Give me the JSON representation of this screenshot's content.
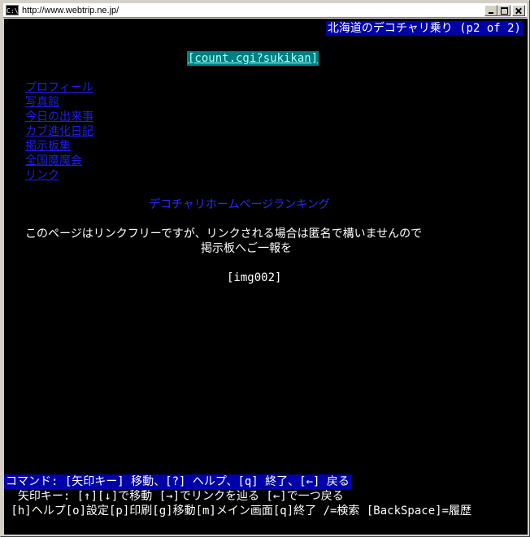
{
  "window": {
    "title": "http://www.webtrip.ne.jp/",
    "icon_label": "C:\\"
  },
  "page": {
    "header_title": "北海道のデコチャリ乗り (p2 of 2)",
    "counter_link": "[count.cgi?sukikan]",
    "nav": [
      {
        "label": "プロフィール"
      },
      {
        "label": "写真館"
      },
      {
        "label": "今日の出来事"
      },
      {
        "label": "カブ進化日記"
      },
      {
        "label": "掲示板集"
      },
      {
        "label": "全国魔魔会"
      },
      {
        "label": "リンク"
      }
    ],
    "ranking_link": "デコチャリホームページランキング",
    "linkfree_line1": "このページはリンクフリーですが、リンクされる場合は匿名で構いませんので",
    "linkfree_line2": "掲示板へご一報を",
    "image_placeholder": "[img002]"
  },
  "footer": {
    "command_bar": "コマンド: [矢印キー] 移動、[?] ヘルプ、[q] 終了、[←] 戻る",
    "arrow_hint": "  矢印キー: [↑][↓]で移動 [→]でリンクを辿る [←]で一つ戻る",
    "keys_hint": " [h]ヘルプ[o]設定[p]印刷[g]移動[m]メイン画面[q]終了 /=検索 [BackSpace]=履歴"
  }
}
